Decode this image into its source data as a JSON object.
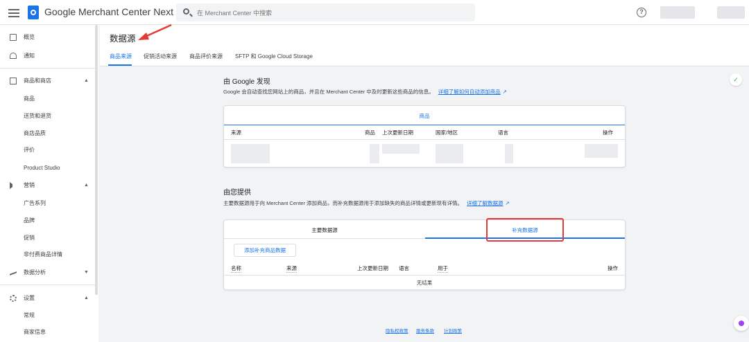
{
  "app": {
    "title": "Google Merchant Center Next"
  },
  "search": {
    "placeholder": "在 Merchant Center 中搜索"
  },
  "sidebar": {
    "items": [
      {
        "label": "概览"
      },
      {
        "label": "通知"
      },
      {
        "label": "商品和商店"
      },
      {
        "label": "商品"
      },
      {
        "label": "送货和退货"
      },
      {
        "label": "商店品质"
      },
      {
        "label": "评价"
      },
      {
        "label": "Product Studio"
      },
      {
        "label": "营销"
      },
      {
        "label": "广告系列"
      },
      {
        "label": "品牌"
      },
      {
        "label": "促销"
      },
      {
        "label": "非付费商品详情"
      },
      {
        "label": "数据分析"
      },
      {
        "label": "设置"
      },
      {
        "label": "常规"
      },
      {
        "label": "商家信息"
      }
    ]
  },
  "page": {
    "title": "数据源",
    "tabs": [
      {
        "label": "商品来源"
      },
      {
        "label": "促销活动来源"
      },
      {
        "label": "商品评价来源"
      },
      {
        "label": "SFTP 和 Google Cloud Storage"
      }
    ]
  },
  "google_section": {
    "title": "由 Google 发现",
    "desc": "Google 会自动查找您网站上的商品，并且在 Merchant Center 中及时更新这些商品的信息。",
    "link": "详细了解如何自动添加商品",
    "card_header": "商品",
    "columns": [
      "来源",
      "商品",
      "上次更新日期",
      "国家/地区",
      "语言",
      "操作"
    ]
  },
  "provided_section": {
    "title": "由您提供",
    "desc": "主要数据源用于向 Merchant Center 添加商品，而补充数据源用于添加缺失的商品详情或更新现有详情。",
    "link": "详细了解数据源",
    "tabs": [
      {
        "label": "主要数据源"
      },
      {
        "label": "补充数据源"
      }
    ],
    "add_button": "添加补充商品数据",
    "columns": [
      "名称",
      "来源",
      "上次更新日期",
      "语言",
      "用于",
      "操作"
    ],
    "empty": "无结果"
  },
  "footer": {
    "links": [
      "隐私权政策",
      "服务条款",
      "计划政策"
    ]
  },
  "colors": {
    "accent": "#1a73e8",
    "highlight": "#e53935"
  }
}
